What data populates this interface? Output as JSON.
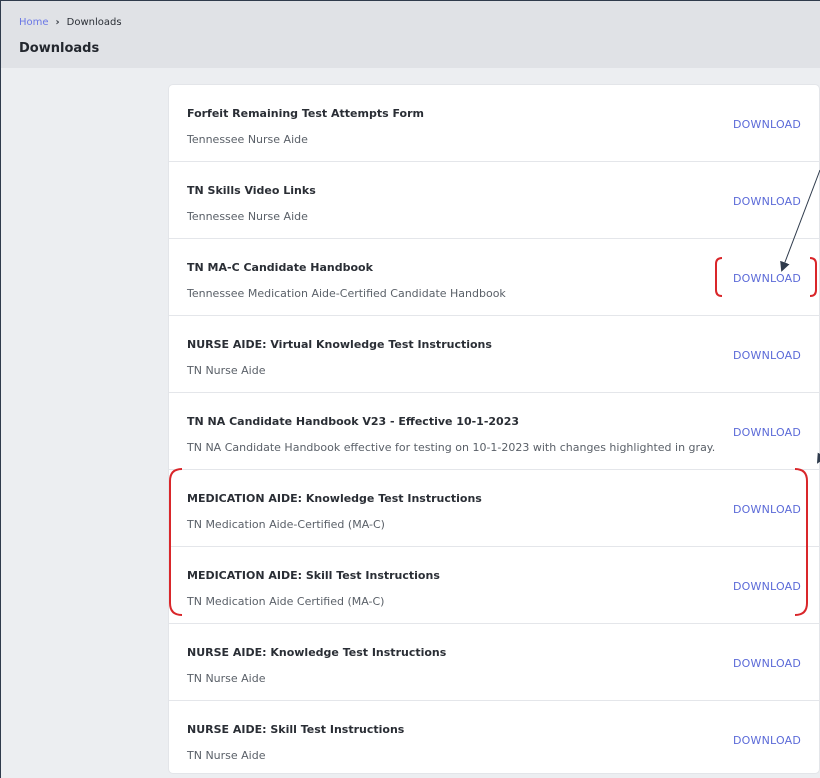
{
  "breadcrumb": {
    "home": "Home",
    "separator": "›",
    "current": "Downloads"
  },
  "page_title": "Downloads",
  "download_label": "DOWNLOAD",
  "items": [
    {
      "title": "Forfeit Remaining Test Attempts Form",
      "subtitle": "Tennessee Nurse Aide"
    },
    {
      "title": "TN Skills Video Links",
      "subtitle": "Tennessee Nurse Aide"
    },
    {
      "title": "TN MA-C Candidate Handbook",
      "subtitle": "Tennessee Medication Aide-Certified Candidate Handbook"
    },
    {
      "title": "NURSE AIDE: Virtual Knowledge Test Instructions",
      "subtitle": "TN Nurse Aide"
    },
    {
      "title": "TN NA Candidate Handbook V23 - Effective 10-1-2023",
      "subtitle": "TN NA Candidate Handbook effective for testing on 10-1-2023 with changes highlighted in gray."
    },
    {
      "title": "MEDICATION AIDE: Knowledge Test Instructions",
      "subtitle": "TN Medication Aide-Certified (MA-C)"
    },
    {
      "title": "MEDICATION AIDE: Skill Test Instructions",
      "subtitle": "TN Medication Aide Certified (MA-C)"
    },
    {
      "title": "NURSE AIDE: Knowledge Test Instructions",
      "subtitle": "TN Nurse Aide"
    },
    {
      "title": "NURSE AIDE: Skill Test Instructions",
      "subtitle": "TN Nurse Aide"
    }
  ],
  "colors": {
    "link": "#6b78e6",
    "download": "#5b6ad8",
    "annotation": "#d9262a",
    "arrow": "#2f3b4c"
  }
}
